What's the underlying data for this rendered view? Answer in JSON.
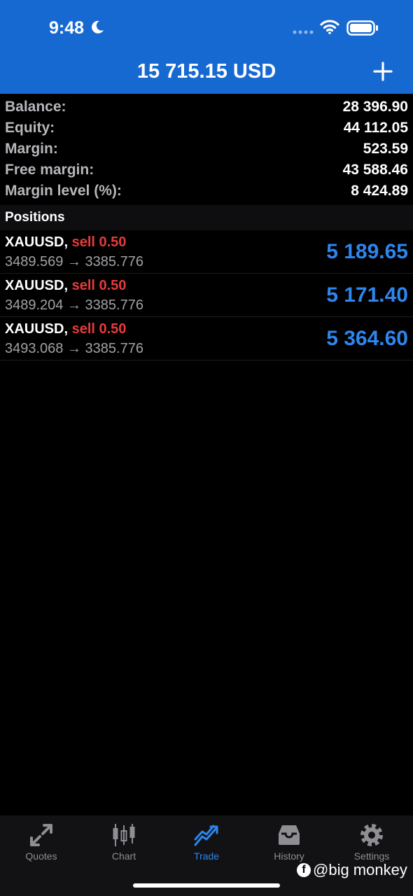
{
  "status": {
    "time": "9:48"
  },
  "header": {
    "title": "15 715.15 USD"
  },
  "summary": [
    {
      "label": "Balance:",
      "value": "28 396.90"
    },
    {
      "label": "Equity:",
      "value": "44 112.05"
    },
    {
      "label": "Margin:",
      "value": "523.59"
    },
    {
      "label": "Free margin:",
      "value": "43 588.46"
    },
    {
      "label": "Margin level (%):",
      "value": "8 424.89"
    }
  ],
  "positions_header": "Positions",
  "positions": [
    {
      "symbol": "XAUUSD,",
      "side": "sell 0.50",
      "prices": "3489.569 → 3385.776",
      "profit": "5 189.65"
    },
    {
      "symbol": "XAUUSD,",
      "side": "sell 0.50",
      "prices": "3489.204 → 3385.776",
      "profit": "5 171.40"
    },
    {
      "symbol": "XAUUSD,",
      "side": "sell 0.50",
      "prices": "3493.068 → 3385.776",
      "profit": "5 364.60"
    }
  ],
  "tabs": [
    {
      "label": "Quotes",
      "icon": "quotes-icon",
      "active": false
    },
    {
      "label": "Chart",
      "icon": "chart-icon",
      "active": false
    },
    {
      "label": "Trade",
      "icon": "trade-icon",
      "active": true
    },
    {
      "label": "History",
      "icon": "history-icon",
      "active": false
    },
    {
      "label": "Settings",
      "icon": "settings-icon",
      "active": false
    }
  ],
  "watermark": {
    "text": "@big monkey",
    "icon": "facebook-icon"
  },
  "colors": {
    "header": "#1769d2",
    "profit": "#2d86ef",
    "sell": "#e83a3a",
    "active_tab": "#2d86ef"
  }
}
